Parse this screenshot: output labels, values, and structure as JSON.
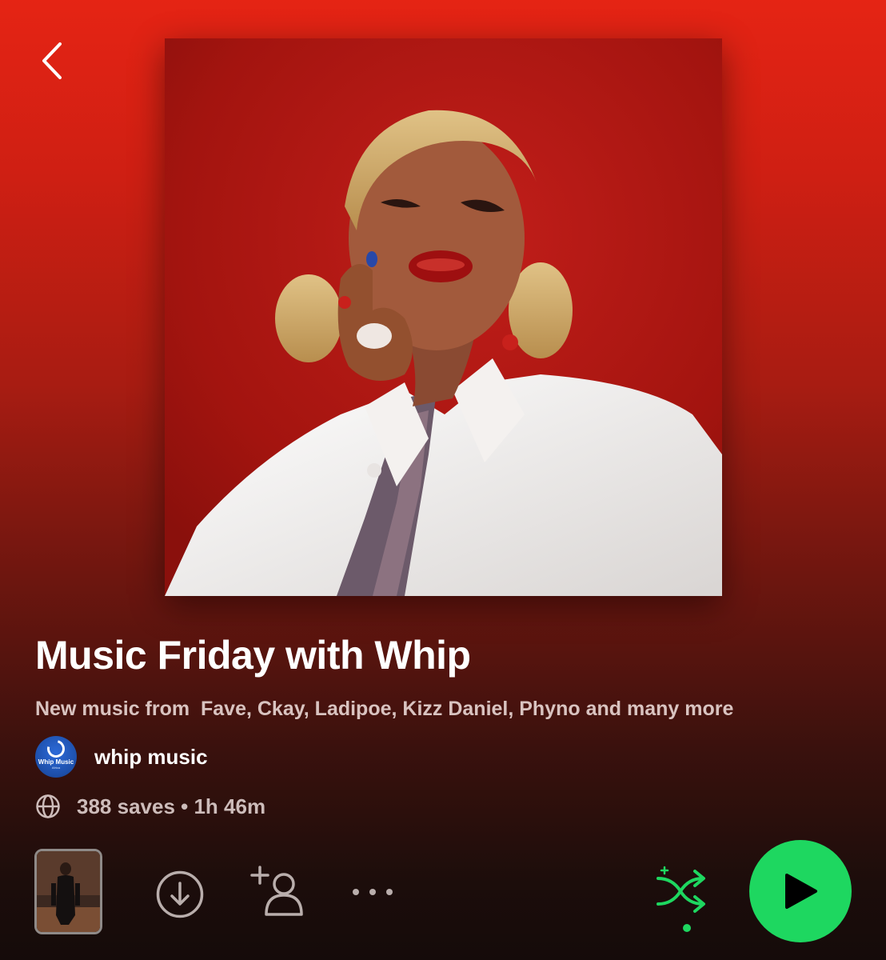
{
  "header": {
    "back_icon": "chevron-left-icon"
  },
  "playlist": {
    "title": "Music Friday with Whip",
    "description": "New music from  Fave, Ckay, Ladipoe, Kizz Daniel, Phyno and many more",
    "owner": {
      "name": "whip music",
      "avatar_text": "Whip Music",
      "avatar_subtext": "Africa"
    },
    "meta": {
      "text": "388 saves • 1h 46m",
      "icon": "globe-icon"
    }
  },
  "actions": {
    "download_icon": "download-icon",
    "add_user_icon": "add-user-icon",
    "more_icon": "more-icon",
    "shuffle_icon": "shuffle-icon",
    "play_icon": "play-icon"
  },
  "colors": {
    "accent_green": "#1ed760",
    "shuffle_green": "#1ed760",
    "background_top": "#e52414",
    "background_bottom": "#150b0a"
  }
}
